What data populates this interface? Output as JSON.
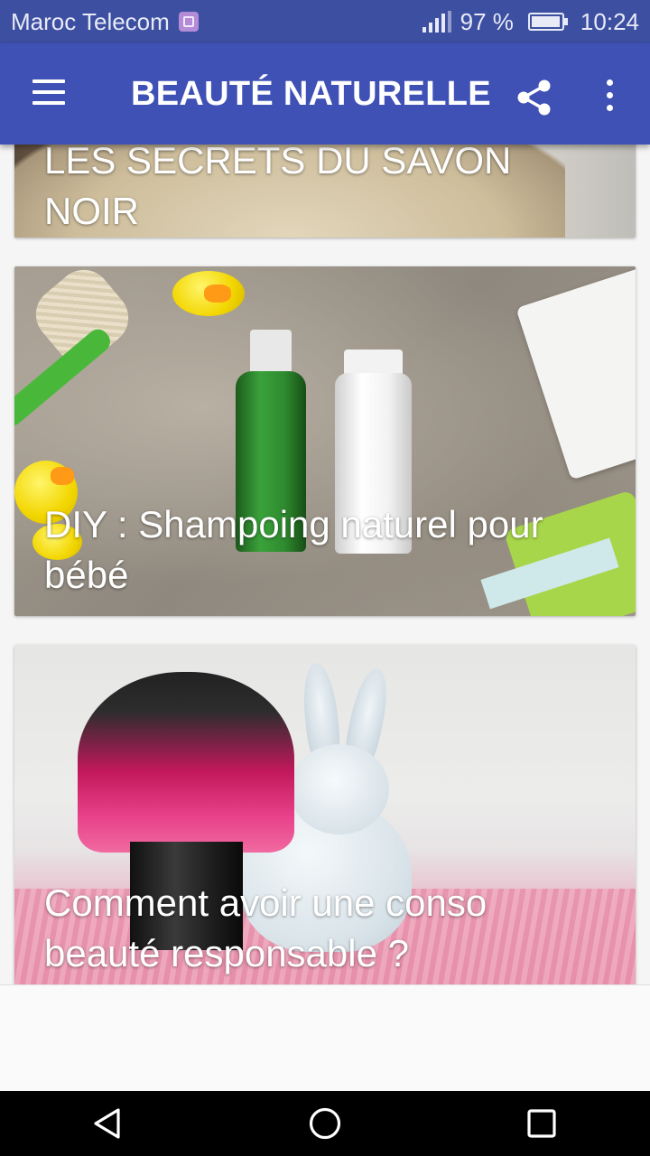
{
  "status_bar": {
    "carrier": "Maroc Telecom",
    "battery_percent": "97 %",
    "battery_level": 0.97,
    "time": "10:24",
    "icons": [
      "sim-card-icon",
      "signal-icon",
      "battery-icon"
    ]
  },
  "app_bar": {
    "title": "BEAUTÉ NATURELLE",
    "icons": [
      "menu-icon",
      "share-icon",
      "more-vert-icon"
    ]
  },
  "articles": [
    {
      "title": "LES SECRETS DU SAVON NOIR"
    },
    {
      "title": "DIY : Shampoing naturel pour bébé"
    },
    {
      "title": "Comment avoir une conso beauté responsable ?"
    }
  ],
  "nav_bar": {
    "icons": [
      "back-icon",
      "home-icon",
      "recents-icon"
    ]
  },
  "colors": {
    "status_bar": "#3c4fa0",
    "app_bar": "#3f51b5",
    "nav_bar": "#000000"
  }
}
